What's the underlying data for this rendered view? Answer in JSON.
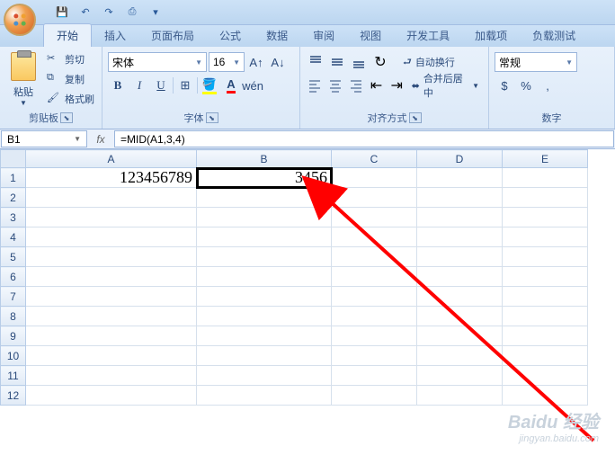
{
  "qat": {
    "save": "💾",
    "undo": "↶",
    "redo": "↷",
    "print": "⎙"
  },
  "tabs": {
    "home": "开始",
    "insert": "插入",
    "layout": "页面布局",
    "formulas": "公式",
    "data": "数据",
    "review": "审阅",
    "view": "视图",
    "dev": "开发工具",
    "addins": "加载项",
    "load": "负载测试"
  },
  "clipboard": {
    "paste": "粘贴",
    "cut": "剪切",
    "copy": "复制",
    "formatpainter": "格式刷",
    "label": "剪贴板"
  },
  "font": {
    "name": "宋体",
    "size": "16",
    "label": "字体"
  },
  "align": {
    "wraptext": "自动换行",
    "merge": "合并后居中",
    "label": "对齐方式"
  },
  "number": {
    "format": "常规",
    "label": "数字"
  },
  "fbar": {
    "cellref": "B1",
    "formula": "=MID(A1,3,4)"
  },
  "cols": {
    "A": "A",
    "B": "B",
    "C": "C",
    "D": "D",
    "E": "E"
  },
  "rows": [
    "1",
    "2",
    "3",
    "4",
    "5",
    "6",
    "7",
    "8",
    "9",
    "10",
    "11",
    "12"
  ],
  "cells": {
    "A1": "123456789",
    "B1": "3456"
  },
  "watermark": {
    "brand": "Baidu 经验",
    "url": "jingyan.baidu.com"
  }
}
